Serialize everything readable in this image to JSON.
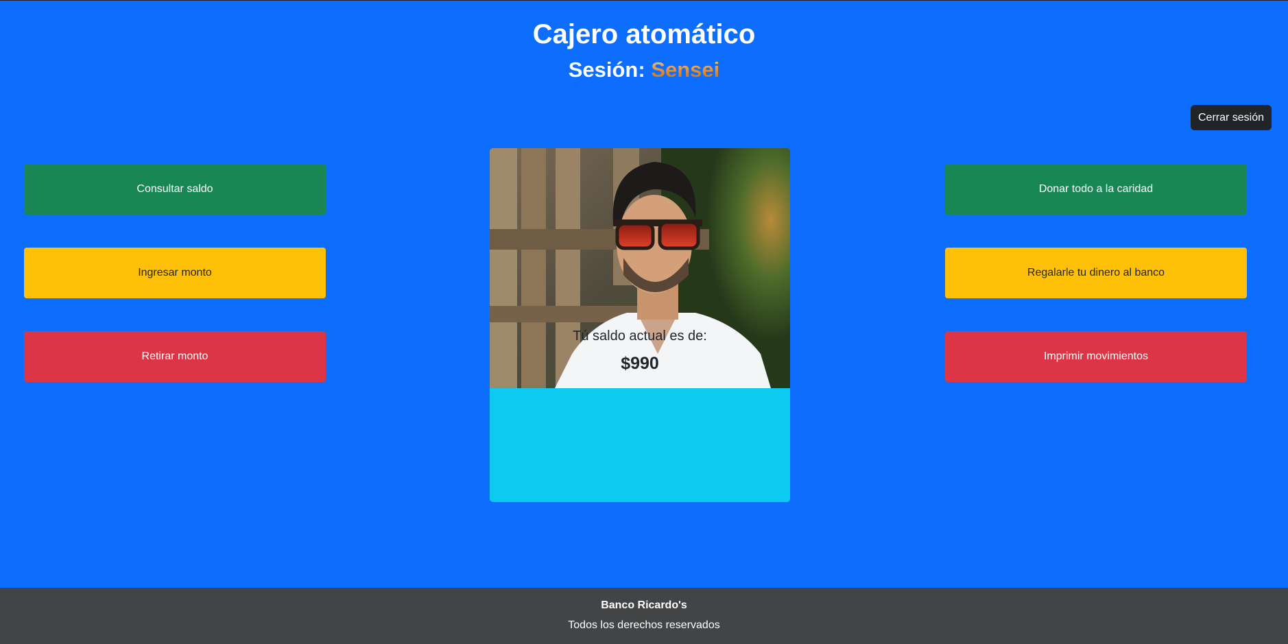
{
  "header": {
    "title": "Cajero atomático",
    "session_prefix": "Sesión:",
    "session_name": "Sensei"
  },
  "logout_label": "Cerrar sesión",
  "left_actions": [
    {
      "label": "Consultar saldo",
      "color": "#198754"
    },
    {
      "label": "Ingresar monto",
      "color": "#ffc107"
    },
    {
      "label": "Retirar monto",
      "color": "#dc3545"
    }
  ],
  "right_actions": [
    {
      "label": "Donar todo a la caridad",
      "color": "#198754"
    },
    {
      "label": "Regalarle tu dinero al banco",
      "color": "#ffc107"
    },
    {
      "label": "Imprimir movimientos",
      "color": "#dc3545"
    }
  ],
  "card": {
    "balance_label": "Tú saldo actual es de:",
    "balance_value": "$990"
  },
  "footer": {
    "title": "Banco Ricardo's",
    "subtitle": "Todos los derechos reservados"
  },
  "colors": {
    "background": "#0d6efd",
    "card_body": "#0dcaf0",
    "footer": "#424446",
    "logout": "#212529"
  }
}
